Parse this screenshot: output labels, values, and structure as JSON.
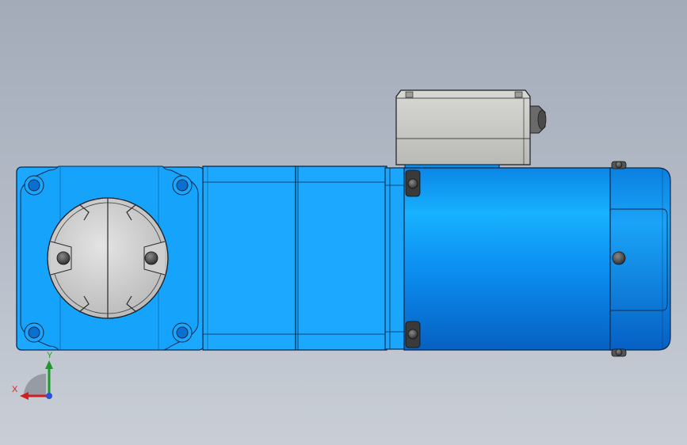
{
  "viewport": {
    "background_top": "#a3abb9",
    "background_bottom": "#c9ced6"
  },
  "colors": {
    "motor_body": "#0a8ff0",
    "gearbox": "#1ca8ff",
    "terminal_box": "#c7c7c3",
    "shaft_cover": "#d2d2d2",
    "outline": "#0b2a4a"
  },
  "triad": {
    "x_label": "X",
    "y_label": "Y",
    "x_color": "#d21e1e",
    "y_color": "#1d9b2a",
    "z_color": "#2a4fd8"
  },
  "icons": {
    "triad": "view-orientation-triad-icon"
  }
}
